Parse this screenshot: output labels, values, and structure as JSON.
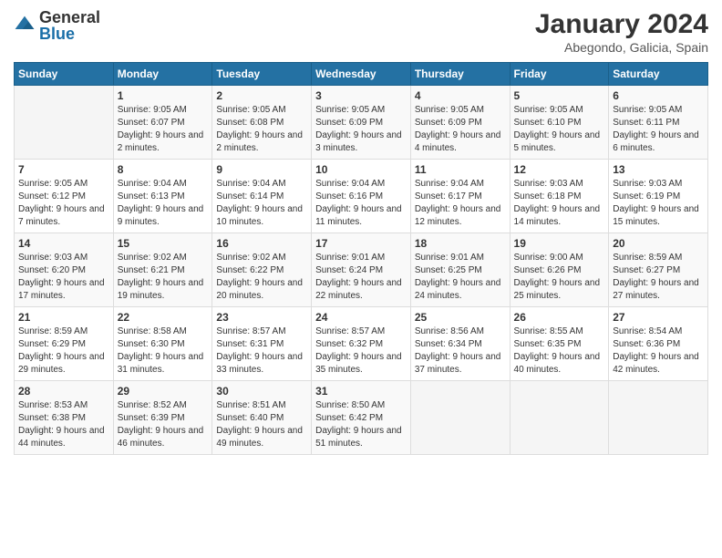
{
  "logo": {
    "general": "General",
    "blue": "Blue"
  },
  "header": {
    "title": "January 2024",
    "location": "Abegondo, Galicia, Spain"
  },
  "weekdays": [
    "Sunday",
    "Monday",
    "Tuesday",
    "Wednesday",
    "Thursday",
    "Friday",
    "Saturday"
  ],
  "weeks": [
    [
      {
        "day": "",
        "empty": true
      },
      {
        "day": "1",
        "sunrise": "Sunrise: 9:05 AM",
        "sunset": "Sunset: 6:07 PM",
        "daylight": "Daylight: 9 hours and 2 minutes."
      },
      {
        "day": "2",
        "sunrise": "Sunrise: 9:05 AM",
        "sunset": "Sunset: 6:08 PM",
        "daylight": "Daylight: 9 hours and 2 minutes."
      },
      {
        "day": "3",
        "sunrise": "Sunrise: 9:05 AM",
        "sunset": "Sunset: 6:09 PM",
        "daylight": "Daylight: 9 hours and 3 minutes."
      },
      {
        "day": "4",
        "sunrise": "Sunrise: 9:05 AM",
        "sunset": "Sunset: 6:09 PM",
        "daylight": "Daylight: 9 hours and 4 minutes."
      },
      {
        "day": "5",
        "sunrise": "Sunrise: 9:05 AM",
        "sunset": "Sunset: 6:10 PM",
        "daylight": "Daylight: 9 hours and 5 minutes."
      },
      {
        "day": "6",
        "sunrise": "Sunrise: 9:05 AM",
        "sunset": "Sunset: 6:11 PM",
        "daylight": "Daylight: 9 hours and 6 minutes."
      }
    ],
    [
      {
        "day": "7",
        "sunrise": "Sunrise: 9:05 AM",
        "sunset": "Sunset: 6:12 PM",
        "daylight": "Daylight: 9 hours and 7 minutes."
      },
      {
        "day": "8",
        "sunrise": "Sunrise: 9:04 AM",
        "sunset": "Sunset: 6:13 PM",
        "daylight": "Daylight: 9 hours and 9 minutes."
      },
      {
        "day": "9",
        "sunrise": "Sunrise: 9:04 AM",
        "sunset": "Sunset: 6:14 PM",
        "daylight": "Daylight: 9 hours and 10 minutes."
      },
      {
        "day": "10",
        "sunrise": "Sunrise: 9:04 AM",
        "sunset": "Sunset: 6:16 PM",
        "daylight": "Daylight: 9 hours and 11 minutes."
      },
      {
        "day": "11",
        "sunrise": "Sunrise: 9:04 AM",
        "sunset": "Sunset: 6:17 PM",
        "daylight": "Daylight: 9 hours and 12 minutes."
      },
      {
        "day": "12",
        "sunrise": "Sunrise: 9:03 AM",
        "sunset": "Sunset: 6:18 PM",
        "daylight": "Daylight: 9 hours and 14 minutes."
      },
      {
        "day": "13",
        "sunrise": "Sunrise: 9:03 AM",
        "sunset": "Sunset: 6:19 PM",
        "daylight": "Daylight: 9 hours and 15 minutes."
      }
    ],
    [
      {
        "day": "14",
        "sunrise": "Sunrise: 9:03 AM",
        "sunset": "Sunset: 6:20 PM",
        "daylight": "Daylight: 9 hours and 17 minutes."
      },
      {
        "day": "15",
        "sunrise": "Sunrise: 9:02 AM",
        "sunset": "Sunset: 6:21 PM",
        "daylight": "Daylight: 9 hours and 19 minutes."
      },
      {
        "day": "16",
        "sunrise": "Sunrise: 9:02 AM",
        "sunset": "Sunset: 6:22 PM",
        "daylight": "Daylight: 9 hours and 20 minutes."
      },
      {
        "day": "17",
        "sunrise": "Sunrise: 9:01 AM",
        "sunset": "Sunset: 6:24 PM",
        "daylight": "Daylight: 9 hours and 22 minutes."
      },
      {
        "day": "18",
        "sunrise": "Sunrise: 9:01 AM",
        "sunset": "Sunset: 6:25 PM",
        "daylight": "Daylight: 9 hours and 24 minutes."
      },
      {
        "day": "19",
        "sunrise": "Sunrise: 9:00 AM",
        "sunset": "Sunset: 6:26 PM",
        "daylight": "Daylight: 9 hours and 25 minutes."
      },
      {
        "day": "20",
        "sunrise": "Sunrise: 8:59 AM",
        "sunset": "Sunset: 6:27 PM",
        "daylight": "Daylight: 9 hours and 27 minutes."
      }
    ],
    [
      {
        "day": "21",
        "sunrise": "Sunrise: 8:59 AM",
        "sunset": "Sunset: 6:29 PM",
        "daylight": "Daylight: 9 hours and 29 minutes."
      },
      {
        "day": "22",
        "sunrise": "Sunrise: 8:58 AM",
        "sunset": "Sunset: 6:30 PM",
        "daylight": "Daylight: 9 hours and 31 minutes."
      },
      {
        "day": "23",
        "sunrise": "Sunrise: 8:57 AM",
        "sunset": "Sunset: 6:31 PM",
        "daylight": "Daylight: 9 hours and 33 minutes."
      },
      {
        "day": "24",
        "sunrise": "Sunrise: 8:57 AM",
        "sunset": "Sunset: 6:32 PM",
        "daylight": "Daylight: 9 hours and 35 minutes."
      },
      {
        "day": "25",
        "sunrise": "Sunrise: 8:56 AM",
        "sunset": "Sunset: 6:34 PM",
        "daylight": "Daylight: 9 hours and 37 minutes."
      },
      {
        "day": "26",
        "sunrise": "Sunrise: 8:55 AM",
        "sunset": "Sunset: 6:35 PM",
        "daylight": "Daylight: 9 hours and 40 minutes."
      },
      {
        "day": "27",
        "sunrise": "Sunrise: 8:54 AM",
        "sunset": "Sunset: 6:36 PM",
        "daylight": "Daylight: 9 hours and 42 minutes."
      }
    ],
    [
      {
        "day": "28",
        "sunrise": "Sunrise: 8:53 AM",
        "sunset": "Sunset: 6:38 PM",
        "daylight": "Daylight: 9 hours and 44 minutes."
      },
      {
        "day": "29",
        "sunrise": "Sunrise: 8:52 AM",
        "sunset": "Sunset: 6:39 PM",
        "daylight": "Daylight: 9 hours and 46 minutes."
      },
      {
        "day": "30",
        "sunrise": "Sunrise: 8:51 AM",
        "sunset": "Sunset: 6:40 PM",
        "daylight": "Daylight: 9 hours and 49 minutes."
      },
      {
        "day": "31",
        "sunrise": "Sunrise: 8:50 AM",
        "sunset": "Sunset: 6:42 PM",
        "daylight": "Daylight: 9 hours and 51 minutes."
      },
      {
        "day": "",
        "empty": true
      },
      {
        "day": "",
        "empty": true
      },
      {
        "day": "",
        "empty": true
      }
    ]
  ]
}
